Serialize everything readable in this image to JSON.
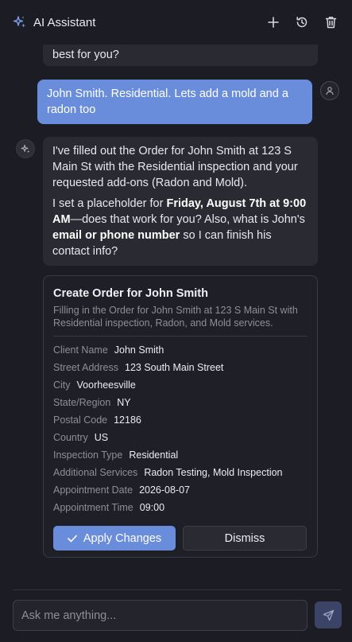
{
  "header": {
    "title": "AI Assistant",
    "logo_icon": "sparkles-icon",
    "actions": [
      "plus-icon",
      "history-icon",
      "trash-icon"
    ]
  },
  "messages": {
    "previous_ai_tail": "best for you?",
    "user": "John Smith. Residential. Lets add a mold and a radon too",
    "ai_para1": "I've filled out the Order for John Smith at 123 S Main St with the Residential inspection and your requested add-ons (Radon and Mold).",
    "ai_para2_pre": "I set a placeholder for ",
    "ai_para2_bold1": "Friday, August 7th at 9:00 AM",
    "ai_para2_mid": "—does that work for you? Also, what is John's ",
    "ai_para2_bold2": "email or phone number",
    "ai_para2_post": " so I can finish his contact info?"
  },
  "card": {
    "title": "Create Order for John Smith",
    "subtitle": "Filling in the Order for John Smith at 123 S Main St with Residential inspection, Radon, and Mold services.",
    "fields": [
      {
        "label": "Client Name",
        "value": "John Smith"
      },
      {
        "label": "Street Address",
        "value": "123 South Main Street"
      },
      {
        "label": "City",
        "value": "Voorheesville"
      },
      {
        "label": "State/Region",
        "value": "NY"
      },
      {
        "label": "Postal Code",
        "value": "12186"
      },
      {
        "label": "Country",
        "value": "US"
      },
      {
        "label": "Inspection Type",
        "value": "Residential"
      },
      {
        "label": "Additional Services",
        "value": "Radon Testing, Mold Inspection"
      },
      {
        "label": "Appointment Date",
        "value": "2026-08-07"
      },
      {
        "label": "Appointment Time",
        "value": "09:00"
      }
    ],
    "apply_label": "Apply Changes",
    "dismiss_label": "Dismiss"
  },
  "composer": {
    "placeholder": "Ask me anything..."
  },
  "colors": {
    "accent": "#6a8ddb",
    "background": "#1c1c24",
    "bubble": "#2a2a33"
  }
}
